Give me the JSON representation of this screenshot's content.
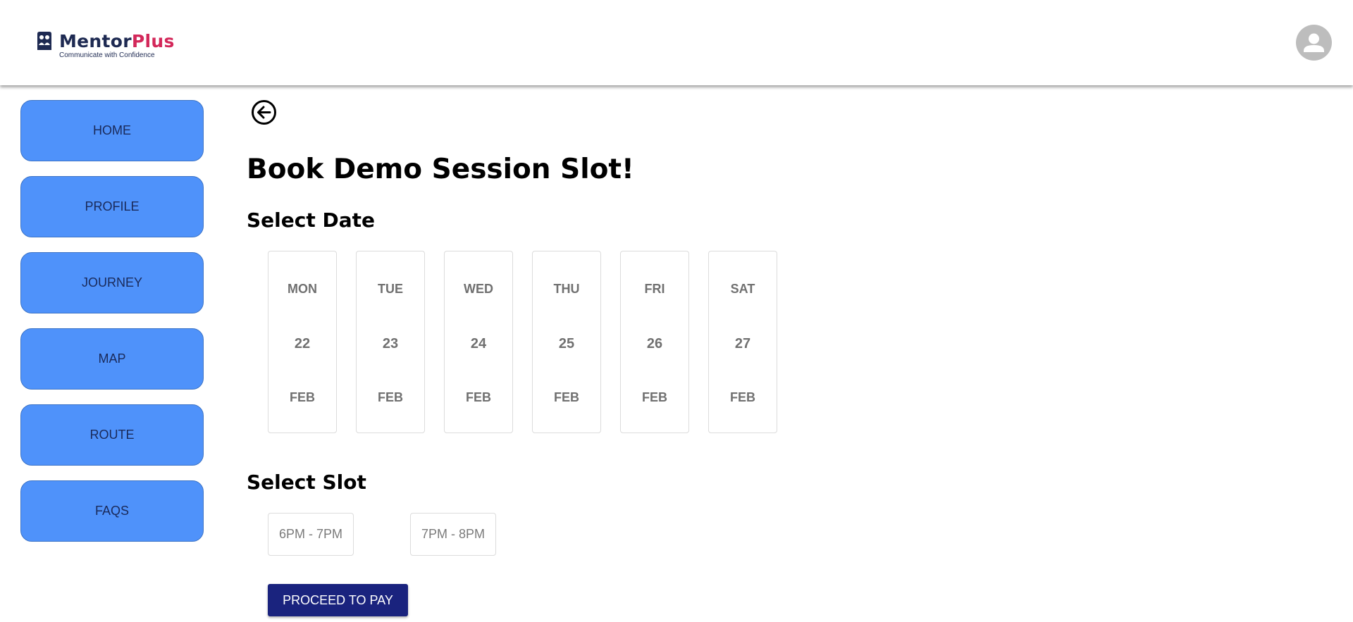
{
  "header": {
    "brand_part1": "Mentor",
    "brand_part2": "Plus",
    "tagline": "Communicate with Confidence",
    "brand_color_dark": "#1e2a52",
    "brand_color_accent": "#d3285a",
    "avatar_icon": "user-avatar-icon"
  },
  "sidebar": {
    "color": "#4f92fa",
    "items": [
      {
        "label": "HOME"
      },
      {
        "label": "PROFILE"
      },
      {
        "label": "JOURNEY"
      },
      {
        "label": "MAP"
      },
      {
        "label": "ROUTE"
      },
      {
        "label": "FAQS"
      }
    ]
  },
  "main": {
    "back_icon": "arrow-left-circle-icon",
    "title": "Book Demo Session Slot!",
    "select_date_heading": "Select Date",
    "dates": [
      {
        "dow": "MON",
        "day": "22",
        "month": "FEB"
      },
      {
        "dow": "TUE",
        "day": "23",
        "month": "FEB"
      },
      {
        "dow": "WED",
        "day": "24",
        "month": "FEB"
      },
      {
        "dow": "THU",
        "day": "25",
        "month": "FEB"
      },
      {
        "dow": "FRI",
        "day": "26",
        "month": "FEB"
      },
      {
        "dow": "SAT",
        "day": "27",
        "month": "FEB"
      }
    ],
    "select_slot_heading": "Select Slot",
    "slots": [
      {
        "label": "6PM - 7PM"
      },
      {
        "label": "7PM - 8PM"
      }
    ],
    "proceed_label": "PROCEED TO PAY",
    "proceed_color": "#1a237e"
  }
}
